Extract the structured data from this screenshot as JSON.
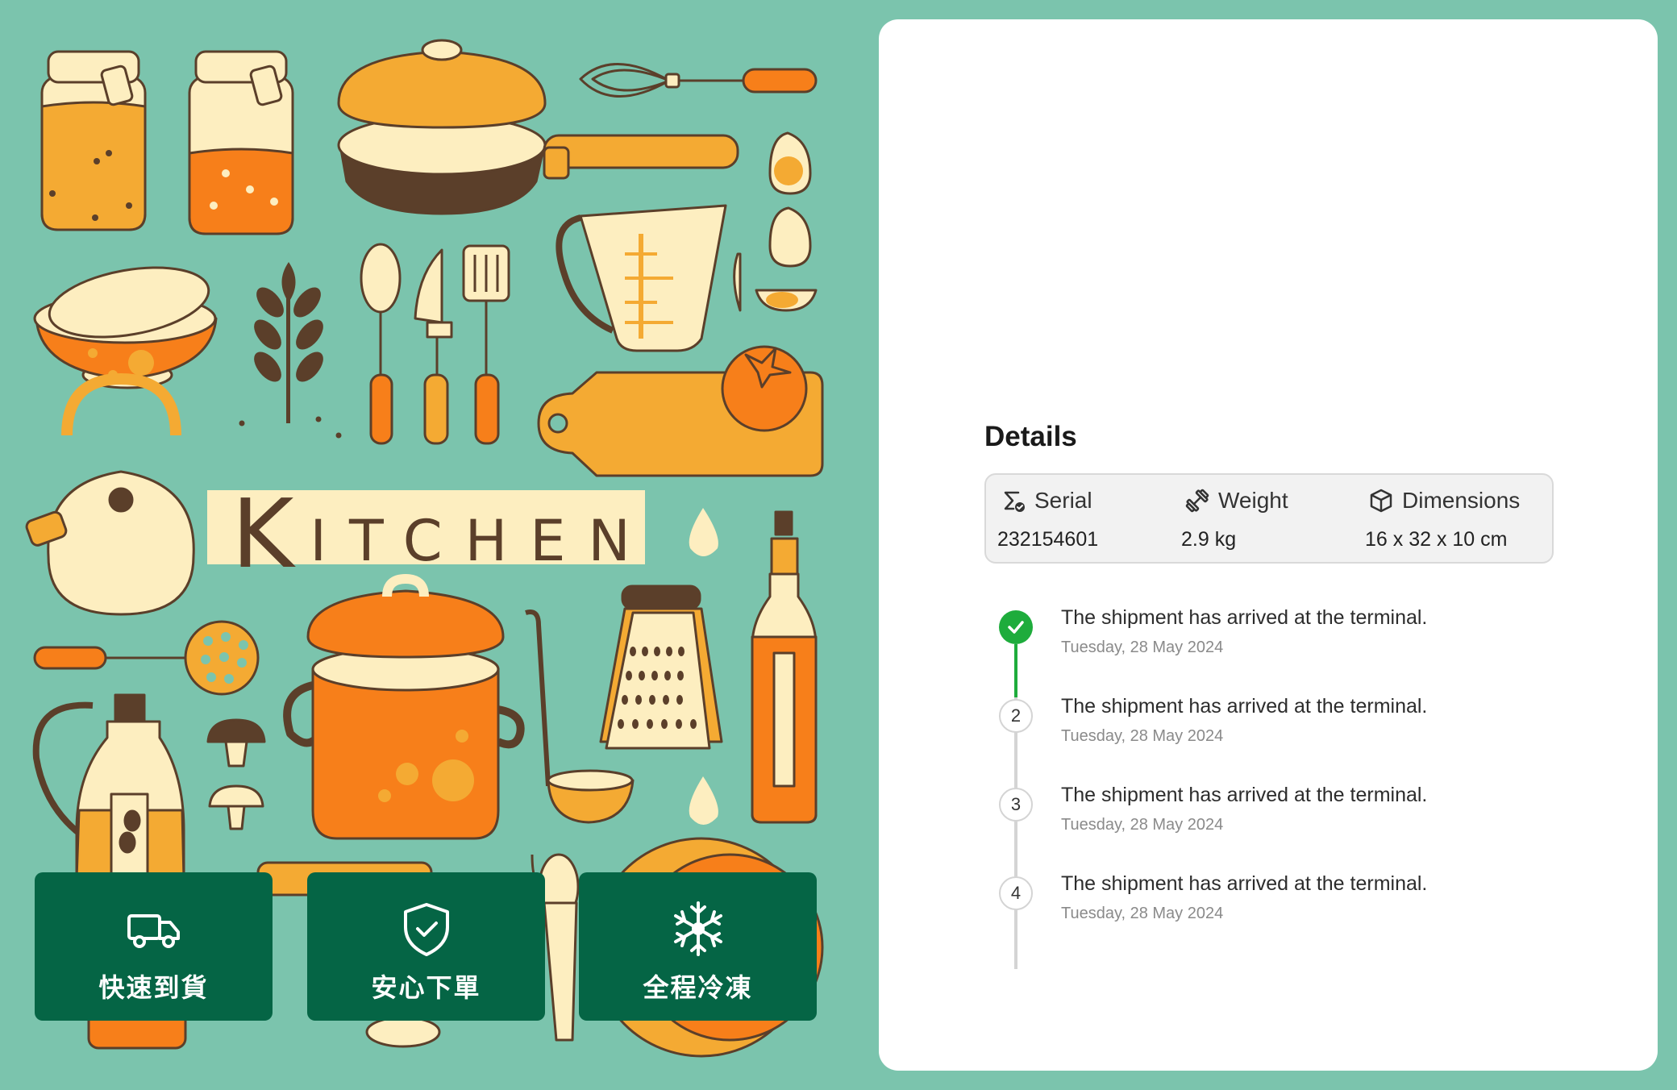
{
  "poster": {
    "word": "KITCHEN",
    "features": [
      {
        "icon": "delivery-truck-icon",
        "label": "快速到貨"
      },
      {
        "icon": "shield-check-icon",
        "label": "安心下單"
      },
      {
        "icon": "snowflake-icon",
        "label": "全程冷凍"
      }
    ]
  },
  "details": {
    "title": "Details",
    "specs": [
      {
        "icon": "serial-sigma-icon",
        "label": "Serial",
        "value": "232154601"
      },
      {
        "icon": "dumbbell-icon",
        "label": "Weight",
        "value": "2.9 kg"
      },
      {
        "icon": "box-icon",
        "label": "Dimensions",
        "value": "16 x 32 x 10 cm"
      }
    ],
    "timeline": [
      {
        "marker": "check",
        "text": "The shipment has arrived at the terminal.",
        "date": "Tuesday, 28 May 2024",
        "status": "done"
      },
      {
        "marker": "2",
        "text": "The shipment has arrived at the terminal.",
        "date": "Tuesday, 28 May 2024",
        "status": "pending"
      },
      {
        "marker": "3",
        "text": "The shipment has arrived at the terminal.",
        "date": "Tuesday, 28 May 2024",
        "status": "pending"
      },
      {
        "marker": "4",
        "text": "The shipment has arrived at the terminal.",
        "date": "Tuesday, 28 May 2024",
        "status": "pending"
      }
    ]
  },
  "colors": {
    "background": "#7bc4ad",
    "feature_green": "#056545",
    "orange": "#f77f1a",
    "amber": "#f4aa33",
    "cream": "#fdeec0",
    "brown": "#5b3f2a",
    "success_green": "#1eac3c"
  }
}
